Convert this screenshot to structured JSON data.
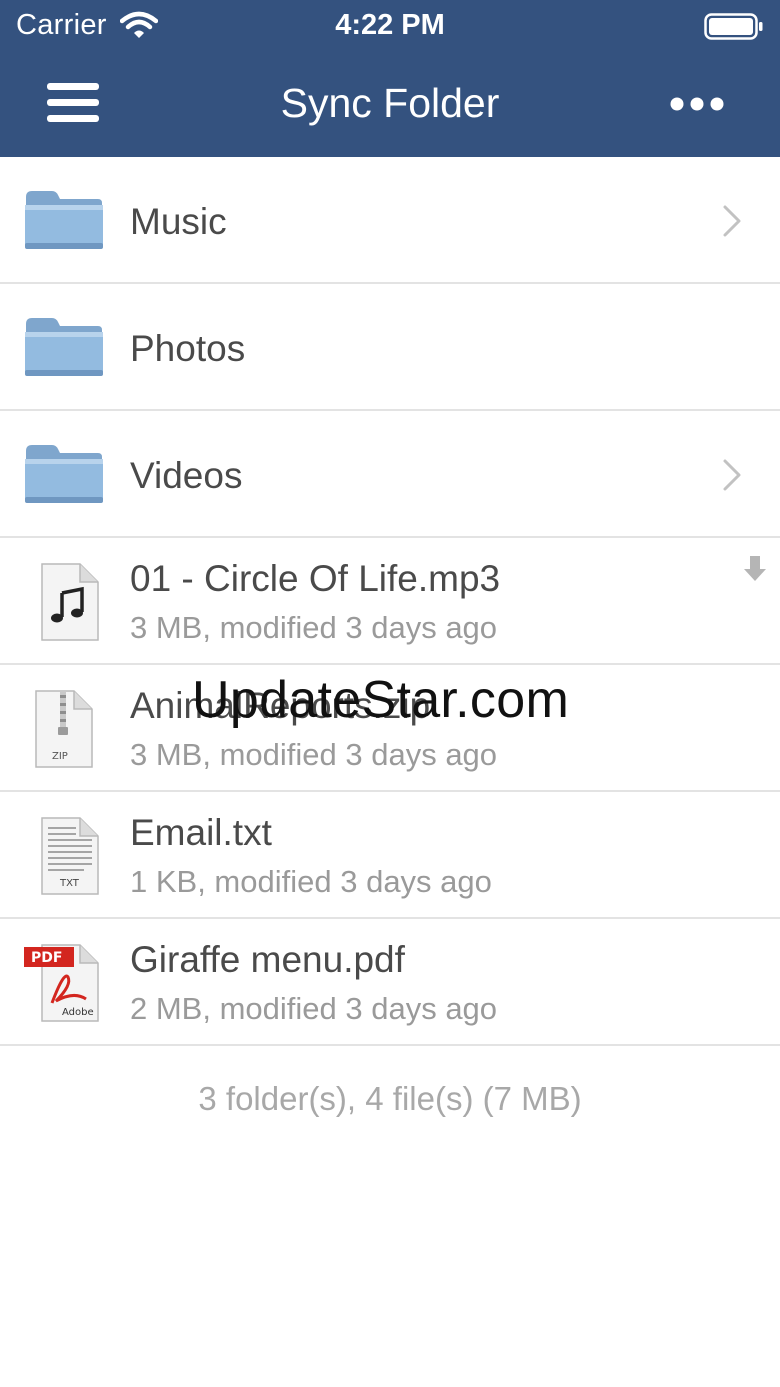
{
  "status_bar": {
    "carrier": "Carrier",
    "time": "4:22 PM"
  },
  "nav": {
    "title": "Sync Folder"
  },
  "folders": [
    {
      "name": "Music",
      "has_chevron": true
    },
    {
      "name": "Photos",
      "has_chevron": false
    },
    {
      "name": "Videos",
      "has_chevron": true
    }
  ],
  "files": [
    {
      "name": "01 - Circle Of Life.mp3",
      "meta": "3 MB, modified 3 days ago",
      "icon": "music-file-icon",
      "downloaded": true
    },
    {
      "name": "AnimalReports.zip",
      "meta": "3 MB, modified 3 days ago",
      "icon": "zip-file-icon",
      "icon_label": "ZIP"
    },
    {
      "name": "Email.txt",
      "meta": "1 KB, modified 3 days ago",
      "icon": "txt-file-icon",
      "icon_label": "TXT"
    },
    {
      "name": "Giraffe menu.pdf",
      "meta": "2 MB, modified 3 days ago",
      "icon": "pdf-file-icon",
      "icon_label": "PDF",
      "icon_sublabel": "Adobe"
    }
  ],
  "summary": "3 folder(s), 4 file(s) (7 MB)",
  "watermark": "UpdateStar.com",
  "colors": {
    "nav_bar": "#34527f",
    "folder": "#8fb6dc",
    "pdf_red": "#d3261f"
  }
}
